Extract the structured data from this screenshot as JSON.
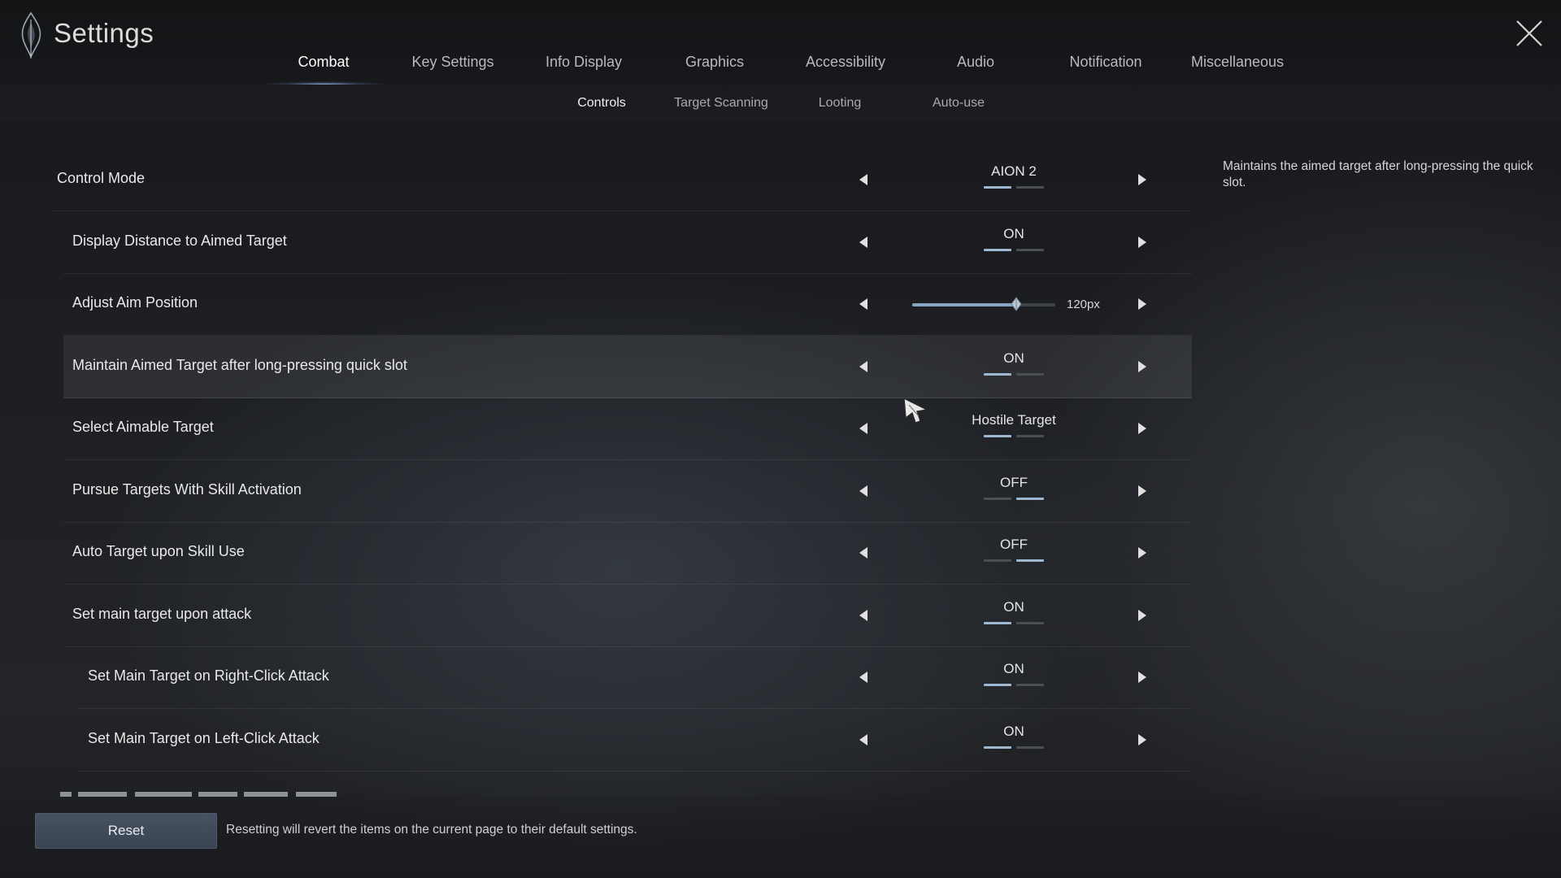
{
  "header": {
    "title": "Settings",
    "main_tabs": [
      {
        "label": "Combat",
        "active": true
      },
      {
        "label": "Key Settings"
      },
      {
        "label": "Info Display"
      },
      {
        "label": "Graphics"
      },
      {
        "label": "Accessibility"
      },
      {
        "label": "Audio"
      },
      {
        "label": "Notification"
      },
      {
        "label": "Miscellaneous"
      }
    ],
    "sub_tabs": [
      {
        "label": "Controls",
        "active": true
      },
      {
        "label": "Target Scanning"
      },
      {
        "label": "Looting"
      },
      {
        "label": "Auto-use"
      }
    ]
  },
  "settings": [
    {
      "label": "Control Mode",
      "value": "AION 2",
      "indicator": 0
    },
    {
      "label": "Display Distance to Aimed Target",
      "value": "ON",
      "indicator": 0
    },
    {
      "label": "Adjust Aim Position",
      "value": "120px",
      "slider_fraction": 0.73
    },
    {
      "label": "Maintain Aimed Target after long-pressing quick slot",
      "value": "ON",
      "indicator": 0
    },
    {
      "label": "Select Aimable Target",
      "value": "Hostile Target",
      "indicator": 0
    },
    {
      "label": "Pursue Targets With Skill Activation",
      "value": "OFF",
      "indicator": 1
    },
    {
      "label": "Auto Target upon Skill Use",
      "value": "OFF",
      "indicator": 1
    },
    {
      "label": "Set main target upon attack",
      "value": "ON",
      "indicator": 0
    },
    {
      "label": "Set Main Target on Right-Click Attack",
      "value": "ON",
      "indicator": 0
    },
    {
      "label": "Set Main Target on Left-Click Attack",
      "value": "ON",
      "indicator": 0
    }
  ],
  "description": "Maintains the aimed target after long-pressing the quick slot.",
  "footer": {
    "reset_label": "Reset",
    "reset_note": "Resetting will revert the items on the current page to their default settings."
  },
  "colors": {
    "accent": "#9fb8cf",
    "slider_fill": "#86a6c4",
    "reset_button": "#3f4a58"
  },
  "icons": {
    "logo": "flame-logo-icon",
    "close": "close-icon",
    "prev": "arrow-left-icon",
    "next": "arrow-right-icon"
  }
}
